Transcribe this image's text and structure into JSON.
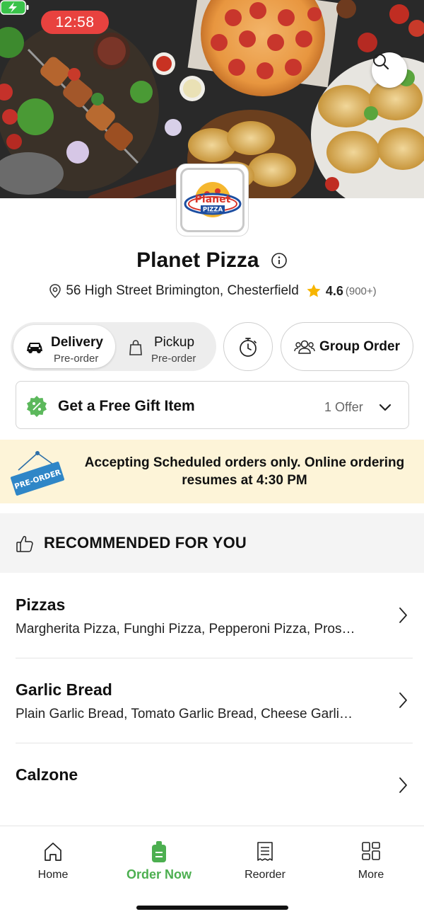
{
  "status_bar": {
    "time": "12:58"
  },
  "restaurant": {
    "name": "Planet Pizza",
    "address": "56 High Street Brimington, Chesterfield",
    "rating": "4.6",
    "rating_count": "(900+)",
    "logo_text_top": "Planet",
    "logo_text_bottom": "PIZZA"
  },
  "order_mode": {
    "delivery": {
      "label": "Delivery",
      "sub": "Pre-order",
      "selected": true
    },
    "pickup": {
      "label": "Pickup",
      "sub": "Pre-order",
      "selected": false
    },
    "group_order_label": "Group Order"
  },
  "offer": {
    "title": "Get a Free Gift Item",
    "count": "1 Offer"
  },
  "banner": {
    "tag": "PRE-ORDER",
    "text": "Accepting Scheduled orders only. Online ordering resumes at 4:30 PM"
  },
  "recommended": {
    "title": "RECOMMENDED FOR YOU",
    "categories": [
      {
        "name": "Pizzas",
        "items": "Margherita Pizza, Funghi Pizza, Pepperoni Pizza, Pros…"
      },
      {
        "name": "Garlic Bread",
        "items": "Plain Garlic Bread, Tomato Garlic Bread, Cheese Garli…"
      },
      {
        "name": "Calzone",
        "items": ""
      }
    ]
  },
  "bottom_nav": {
    "items": [
      {
        "label": "Home",
        "icon": "home-icon",
        "active": false
      },
      {
        "label": "Order Now",
        "icon": "order-icon",
        "active": true
      },
      {
        "label": "Reorder",
        "icon": "receipt-icon",
        "active": false
      },
      {
        "label": "More",
        "icon": "grid-icon",
        "active": false
      }
    ]
  },
  "colors": {
    "accent": "#4caf50",
    "banner_bg": "#fdf4d8",
    "status_time_bg": "#e8423f",
    "star": "#f7b500"
  }
}
